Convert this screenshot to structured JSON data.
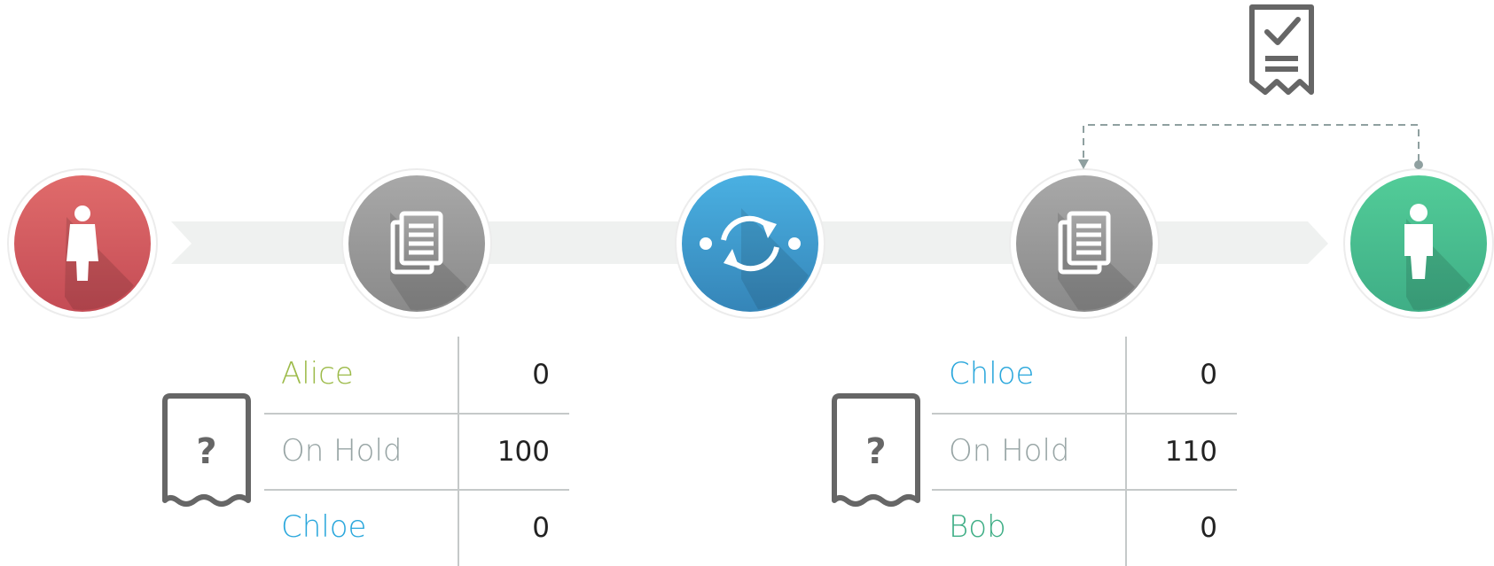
{
  "colors": {
    "track": "#eff1f0",
    "sender": "#d95f5f",
    "document": "#9a9a9a",
    "exchange": "#3f9bd0",
    "receiver": "#4cbf8f",
    "alice": "#9dbb4a",
    "chloe": "#2aa7dc",
    "bob": "#3fae86",
    "on_hold": "#97a4a4",
    "grid": "#c5c9c9",
    "icon_gray": "#666666",
    "dash": "#8fa0a0"
  },
  "nodes": [
    {
      "icon": "woman-icon",
      "role": "sender"
    },
    {
      "icon": "documents-icon",
      "role": "document"
    },
    {
      "icon": "exchange-sync-icon",
      "role": "exchange"
    },
    {
      "icon": "documents-icon",
      "role": "document"
    },
    {
      "icon": "man-icon",
      "role": "receiver"
    }
  ],
  "receipt_icon": "check-receipt-icon",
  "tables": [
    {
      "ticket": "?",
      "rows": [
        {
          "name": "Alice",
          "value": "0",
          "color": "#9dbb4a"
        },
        {
          "name": "On Hold",
          "value": "100",
          "color": "#97a4a4"
        },
        {
          "name": "Chloe",
          "value": "0",
          "color": "#2aa7dc"
        }
      ]
    },
    {
      "ticket": "?",
      "rows": [
        {
          "name": "Chloe",
          "value": "0",
          "color": "#2aa7dc"
        },
        {
          "name": "On Hold",
          "value": "110",
          "color": "#97a4a4"
        },
        {
          "name": "Bob",
          "value": "0",
          "color": "#3fae86"
        }
      ]
    }
  ]
}
